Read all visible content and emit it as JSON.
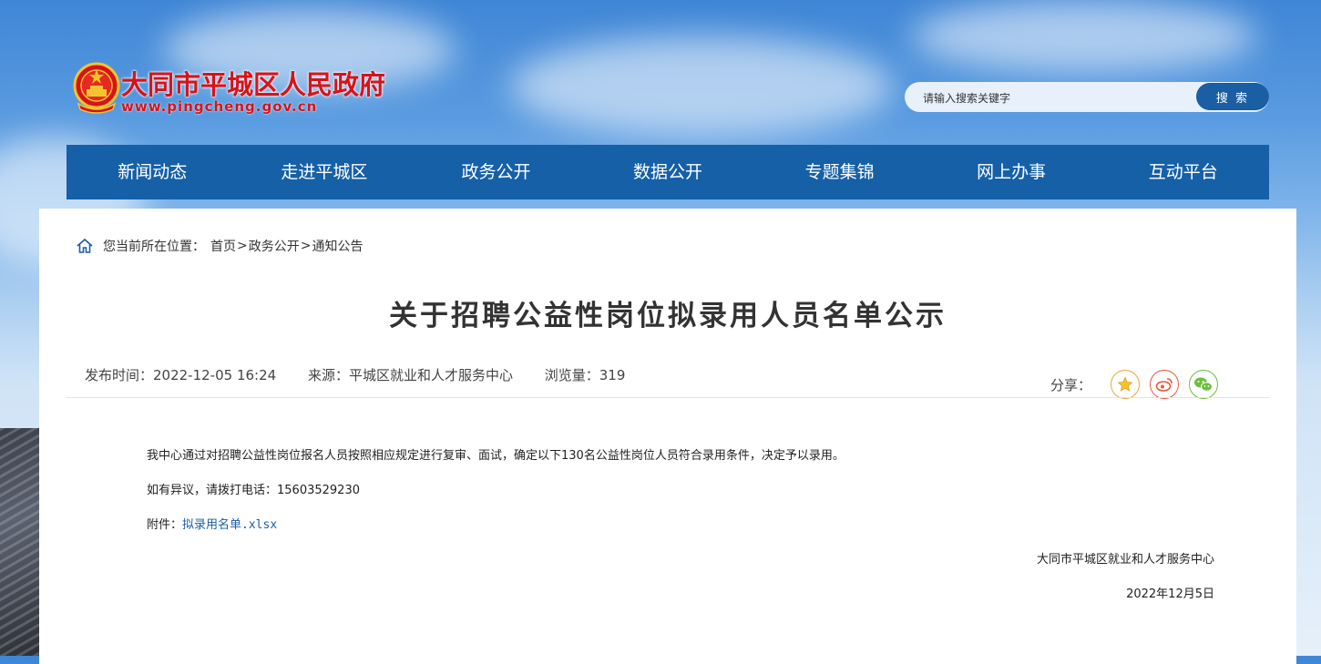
{
  "header": {
    "site_title": "大同市平城区人民政府",
    "site_url": "www.pingcheng.gov.cn",
    "search_placeholder": "请输入搜索关键字",
    "search_button": "搜 索"
  },
  "nav": {
    "items": [
      "新闻动态",
      "走进平城区",
      "政务公开",
      "数据公开",
      "专题集锦",
      "网上办事",
      "互动平台"
    ]
  },
  "breadcrumb": {
    "prefix": "您当前所在位置：",
    "items": [
      "首页",
      "政务公开",
      "通知公告"
    ],
    "separator": ">"
  },
  "article": {
    "title": "关于招聘公益性岗位拟录用人员名单公示",
    "publish_time": "发布时间：2022-12-05 16:24",
    "source": "来源：平城区就业和人才服务中心",
    "views": "浏览量：319",
    "paragraph1": "我中心通过对招聘公益性岗位报名人员按照相应规定进行复审、面试，确定以下130名公益性岗位人员符合录用条件，决定予以录用。",
    "paragraph2": "如有异议，请拨打电话：15603529230",
    "attachment_label": "附件：",
    "attachment_link": "拟录用名单.xlsx",
    "signature_org": "大同市平城区就业和人才服务中心",
    "signature_date": "2022年12月5日"
  },
  "share": {
    "label": "分享：",
    "icons": [
      "star-icon",
      "weibo-icon",
      "wechat-icon"
    ]
  },
  "colors": {
    "brand_red": "#d8121a",
    "nav_blue": "#1660a8",
    "link_blue": "#1a5ea4"
  }
}
